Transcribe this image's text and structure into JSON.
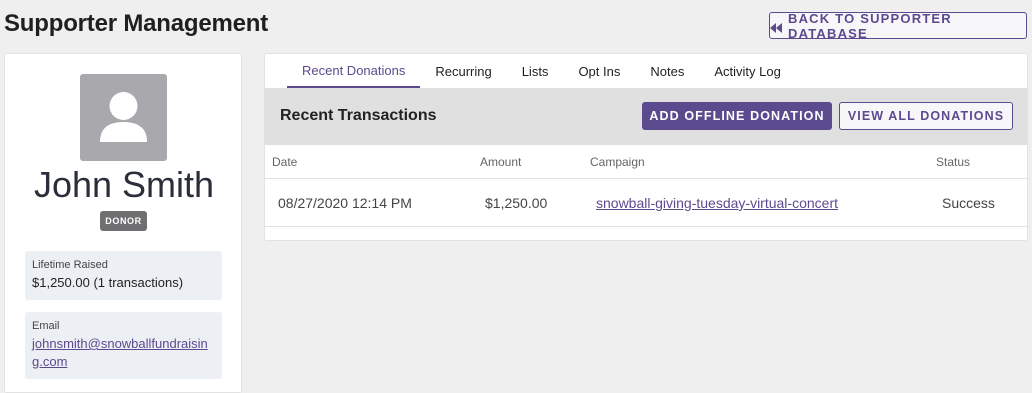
{
  "page": {
    "title": "Supporter Management",
    "back_button_label": "BACK TO SUPPORTER DATABASE"
  },
  "profile": {
    "name": "John Smith",
    "badge": "DONOR",
    "lifetime": {
      "label": "Lifetime Raised",
      "value": "$1,250.00 (1 transactions)"
    },
    "email": {
      "label": "Email",
      "value": "johnsmith@snowballfundraising.com"
    }
  },
  "tabs": [
    {
      "label": "Recent Donations",
      "active": true
    },
    {
      "label": "Recurring"
    },
    {
      "label": "Lists"
    },
    {
      "label": "Opt Ins"
    },
    {
      "label": "Notes"
    },
    {
      "label": "Activity Log"
    }
  ],
  "transactions": {
    "title": "Recent Transactions",
    "add_offline_label": "ADD OFFLINE DONATION",
    "view_all_label": "VIEW ALL DONATIONS",
    "columns": {
      "date": "Date",
      "amount": "Amount",
      "campaign": "Campaign",
      "status": "Status"
    },
    "rows": [
      {
        "date": "08/27/2020 12:14 PM",
        "amount": "$1,250.00",
        "campaign": "snowball-giving-tuesday-virtual-concert",
        "status": "Success"
      }
    ]
  },
  "colors": {
    "accent": "#5c4a8f",
    "background": "#efefef",
    "badge": "#6f6f72"
  },
  "icons": {
    "back": "rewind-icon",
    "avatar": "user-silhouette-icon"
  }
}
